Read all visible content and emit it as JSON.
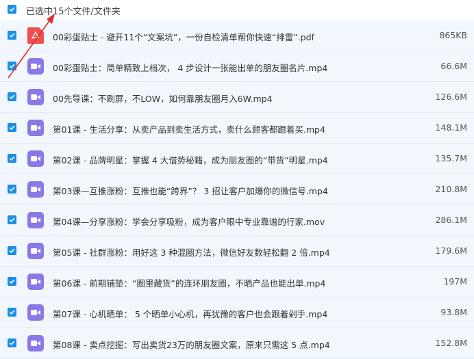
{
  "header": {
    "selected_label": "已选中15个文件/文件夹"
  },
  "colors": {
    "accent": "#1a8fe6",
    "video_icon": "#8a78e6",
    "pdf_icon": "#ef4f4f",
    "arrow": "#e02b2b"
  },
  "files": [
    {
      "name": "00彩蛋贴士 - 避开11个“文案坑”，一份自检清单帮你快速“排雷”.pdf",
      "size": "865KB",
      "icon": "pdf-file-icon"
    },
    {
      "name": "00彩蛋贴士：简单精致上档次， 4 步设计一张能出单的朋友圈名片.mp4",
      "size": "66.6M",
      "icon": "video-file-icon"
    },
    {
      "name": "00先导课：不刷屏，不LOW，如何靠朋友圈月入6W.mp4",
      "size": "126.6M",
      "icon": "video-file-icon"
    },
    {
      "name": "第01课 - 生活分享：从卖产品到卖生活方式，卖什么顾客都跟着买.mp4",
      "size": "148.1M",
      "icon": "video-file-icon"
    },
    {
      "name": "第02课 - 品牌明星：掌握 4 大借势秘籍，成为朋友圈的“带货”明星.mp4",
      "size": "135.7M",
      "icon": "video-file-icon"
    },
    {
      "name": "第03课—互推涨粉：互推也能“跨界”？ 3 招让客户加爆你的微信号.mp4",
      "size": "210.8M",
      "icon": "video-file-icon"
    },
    {
      "name": "第04课—分享涨粉：学会分享吸粉，成为客户眼中专业靠谱的行家.mov",
      "size": "286.1M",
      "icon": "video-file-icon"
    },
    {
      "name": "第05课 - 社群涨粉：用好这 3 种混圈方法，微信好友数轻松翻 2 倍.mp4",
      "size": "179.6M",
      "icon": "video-file-icon"
    },
    {
      "name": "第06课 - 前期铺垫：“圈里藏货”的连环朋友圈，不晒产品也能出单.mp4",
      "size": "197M",
      "icon": "video-file-icon"
    },
    {
      "name": "第07课 - 心机晒单： 5 个晒单小心机，再犹豫的客户也会跟着剁手.mp4",
      "size": "93.8M",
      "icon": "video-file-icon"
    },
    {
      "name": "第08课 - 卖点挖掘：写出卖货23万的朋友圈文案，原来只需这 5 点.mp4",
      "size": "152.8M",
      "icon": "video-file-icon"
    }
  ]
}
